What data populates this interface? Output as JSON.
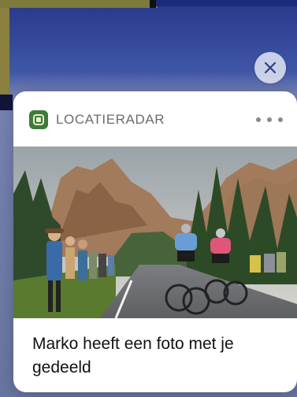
{
  "notification": {
    "app_name": "LOCATIERADAR",
    "app_icon": "locatieradar-app-icon",
    "message": "Marko heeft een foto met je gedeeld",
    "photo_alt": "cycling-photo",
    "accent_color": "#3f7a3a"
  },
  "controls": {
    "close_icon": "close-icon",
    "more_icon": "more-options-icon"
  }
}
